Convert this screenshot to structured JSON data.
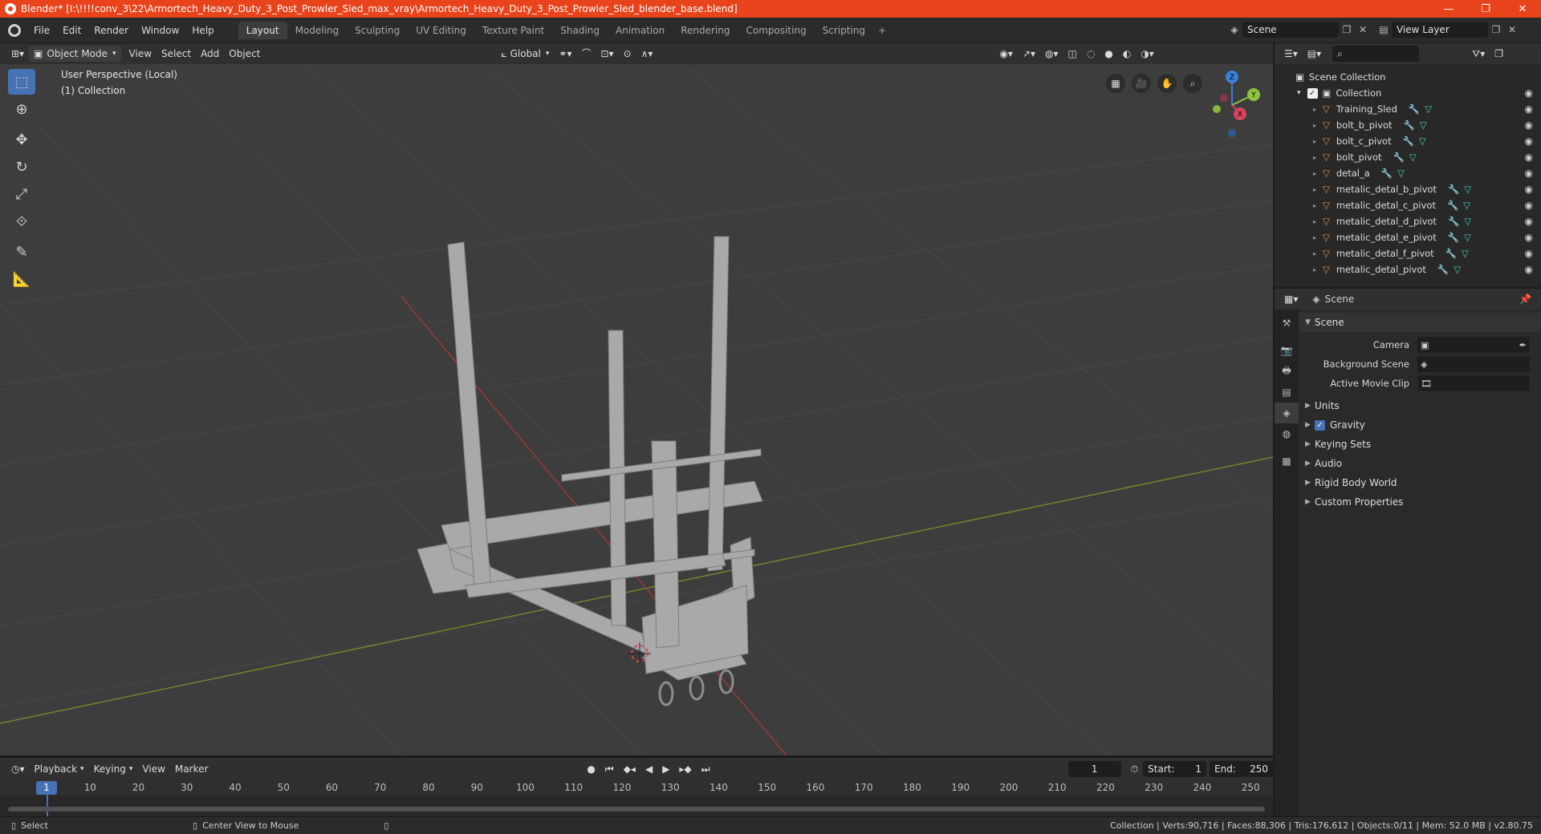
{
  "window": {
    "title": "Blender* [I:\\!!!!conv_3\\22\\Armortech_Heavy_Duty_3_Post_Prowler_Sled_max_vray\\Armortech_Heavy_Duty_3_Post_Prowler_Sled_blender_base.blend]",
    "minimize": "—",
    "maximize": "❐",
    "close": "✕"
  },
  "menu": {
    "file": "File",
    "edit": "Edit",
    "render": "Render",
    "window": "Window",
    "help": "Help"
  },
  "workspaces": [
    "Layout",
    "Modeling",
    "Sculpting",
    "UV Editing",
    "Texture Paint",
    "Shading",
    "Animation",
    "Rendering",
    "Compositing",
    "Scripting"
  ],
  "scene_selector": {
    "value": "Scene"
  },
  "view_layer": {
    "value": "View Layer"
  },
  "viewport_header": {
    "mode": "Object Mode",
    "view": "View",
    "select": "Select",
    "add": "Add",
    "object": "Object",
    "orientation": "Global"
  },
  "viewport": {
    "perspective_label": "User Perspective (Local)",
    "collection_label": "(1) Collection",
    "gizmo_axes": {
      "x": "X",
      "y": "Y",
      "z": "Z"
    },
    "colors": {
      "background": "#3d3d3d",
      "grid": "#474747",
      "x_axis": "#9a3a3a",
      "y_axis": "#6b8a2a",
      "mesh": "#a9a9a9",
      "active_tool": "#4772b3"
    }
  },
  "outliner": {
    "root": "Scene Collection",
    "collection": "Collection",
    "objects": [
      "Training_Sled",
      "bolt_b_pivot",
      "bolt_c_pivot",
      "bolt_pivot",
      "detal_a",
      "metalic_detal_b_pivot",
      "metalic_detal_c_pivot",
      "metalic_detal_d_pivot",
      "metalic_detal_e_pivot",
      "metalic_detal_f_pivot",
      "metalic_detal_pivot"
    ]
  },
  "properties": {
    "header": "Scene",
    "section_scene": "Scene",
    "camera_label": "Camera",
    "background_scene_label": "Background Scene",
    "active_clip_label": "Active Movie Clip",
    "sections": [
      "Units",
      "Gravity",
      "Keying Sets",
      "Audio",
      "Rigid Body World",
      "Custom Properties"
    ],
    "gravity_checked": true
  },
  "timeline": {
    "playback": "Playback",
    "keying": "Keying",
    "view": "View",
    "marker": "Marker",
    "current_frame": "1",
    "start_label": "Start:",
    "start": "1",
    "end_label": "End:",
    "end": "250",
    "ruler": [
      "10",
      "20",
      "30",
      "40",
      "50",
      "60",
      "70",
      "80",
      "90",
      "100",
      "110",
      "120",
      "130",
      "140",
      "150",
      "160",
      "170",
      "180",
      "190",
      "200",
      "210",
      "220",
      "230",
      "240",
      "250"
    ],
    "ruler_current": "1"
  },
  "status": {
    "select": "Select",
    "center_view": "Center View to Mouse",
    "stats": "Collection | Verts:90,716 | Faces:88,306 | Tris:176,612 | Objects:0/11 | Mem: 52.0 MB | v2.80.75"
  }
}
